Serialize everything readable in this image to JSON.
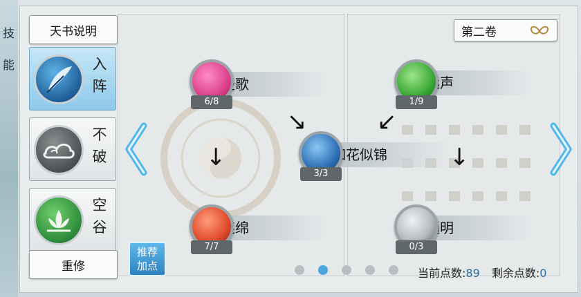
{
  "side_labels": [
    "技",
    "能"
  ],
  "left_panel": {
    "top_button": "天书说明",
    "modes": [
      {
        "name": "入阵",
        "chars": [
          "入",
          "阵"
        ],
        "icon": "feather-icon",
        "active": true
      },
      {
        "name": "不破",
        "chars": [
          "不",
          "破"
        ],
        "icon": "cloud-icon",
        "active": false
      },
      {
        "name": "空谷",
        "chars": [
          "空",
          "谷"
        ],
        "icon": "lotus-icon",
        "active": false
      }
    ],
    "bottom_button": "重修"
  },
  "recommend_button": "推荐\n加点",
  "volume_selector": {
    "label": "第二卷",
    "icon": "butterfly-icon"
  },
  "skills": [
    {
      "name": "轻歌",
      "count": "6/8",
      "color": "#e0559a"
    },
    {
      "name": "连绵",
      "count": "7/7",
      "color": "#e05a2a"
    },
    {
      "name": "如花似锦",
      "count": "3/3",
      "color": "#2f6fb6"
    },
    {
      "name": "远声",
      "count": "1/9",
      "color": "#3aa834"
    },
    {
      "name": "通明",
      "count": "0/3",
      "color": "#8a8f92"
    }
  ],
  "pagination": {
    "pages": 5,
    "active_index": 1
  },
  "points": {
    "current_label": "当前点数:",
    "current_value": "89",
    "remaining_label": "剩余点数:",
    "remaining_value": "0"
  }
}
